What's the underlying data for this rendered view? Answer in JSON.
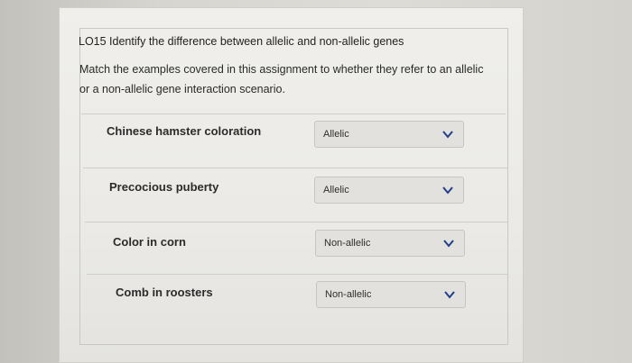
{
  "question": {
    "title": "LO15 Identify the difference between allelic and non-allelic genes",
    "instructions": "Match the examples covered in this assignment to whether they refer to an allelic or a non-allelic gene interaction scenario."
  },
  "rows": [
    {
      "label": "Chinese hamster coloration",
      "selected": "Allelic"
    },
    {
      "label": "Precocious puberty",
      "selected": "Allelic"
    },
    {
      "label": "Color in corn",
      "selected": "Non-allelic"
    },
    {
      "label": "Comb in roosters",
      "selected": "Non-allelic"
    }
  ],
  "icons": {
    "dropdown": "chevron-down-icon"
  },
  "colors": {
    "chevron": "#1f3e8c"
  }
}
